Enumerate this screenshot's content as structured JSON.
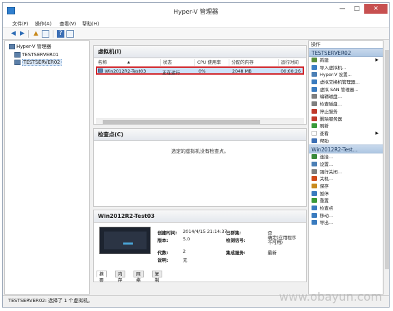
{
  "window": {
    "title": "Hyper-V 管理器",
    "minimize": "—",
    "maximize": "□",
    "close": "✕"
  },
  "menu": [
    "文件(F)",
    "操作(A)",
    "查看(V)",
    "帮助(H)"
  ],
  "tree": {
    "root": "Hyper-V 管理器",
    "servers": [
      "TESTSERVER01",
      "TESTSERVER02"
    ]
  },
  "vm_panel": {
    "title": "虚拟机(I)",
    "columns": [
      "名称",
      "状态",
      "CPU 使用率",
      "分配的内存",
      "运行时间"
    ],
    "rows": [
      {
        "name": "Win2012R2-Test03",
        "state": "正在运行",
        "cpu": "0%",
        "memory": "2048 MB",
        "uptime": "00:00:26"
      }
    ]
  },
  "checkpoint_panel": {
    "title": "检查点(C)",
    "empty_message": "选定的虚拟机没有检查点。"
  },
  "details": {
    "title": "Win2012R2-Test03",
    "fields": [
      {
        "label": "创建时间:",
        "value": "2014/4/15 21:14:37"
      },
      {
        "label": "版本:",
        "value": "5.0"
      },
      {
        "label": "代数:",
        "value": "2"
      },
      {
        "label": "说明:",
        "value": "无"
      },
      {
        "label": "已群集:",
        "value": "否"
      },
      {
        "label": "检测信号:",
        "value": "确定(应用程序不可用)"
      },
      {
        "label": "集成服务:",
        "value": "最新"
      }
    ],
    "tabs": [
      "摘要",
      "内存",
      "网络",
      "复制"
    ]
  },
  "actions": {
    "header": "操作",
    "server_group": "TESTSERVER02",
    "server_items": [
      {
        "label": "新建",
        "icon": "new-icon",
        "color": "#5a8f3c",
        "submenu": true
      },
      {
        "label": "导入虚拟机...",
        "icon": "import-icon",
        "color": "#3c7fc4"
      },
      {
        "label": "Hyper-V 设置...",
        "icon": "settings-icon",
        "color": "#4b7fb5"
      },
      {
        "label": "虚拟交换机管理器...",
        "icon": "switch-icon",
        "color": "#3a7bbf"
      },
      {
        "label": "虚拟 SAN 管理器...",
        "icon": "san-icon",
        "color": "#3a7bbf"
      },
      {
        "label": "编辑磁盘...",
        "icon": "edit-disk-icon",
        "color": "#7f7f7f"
      },
      {
        "label": "检查磁盘...",
        "icon": "inspect-disk-icon",
        "color": "#7f7f7f"
      },
      {
        "label": "停止服务",
        "icon": "stop-service-icon",
        "color": "#c0392b"
      },
      {
        "label": "删除服务器",
        "icon": "remove-server-icon",
        "color": "#c0392b"
      },
      {
        "label": "刷新",
        "icon": "refresh-icon",
        "color": "#3a9a3a"
      },
      {
        "label": "查看",
        "icon": "view-icon",
        "color": "#ffffff",
        "submenu": true
      },
      {
        "label": "帮助",
        "icon": "help-icon",
        "color": "#3c6fb5"
      }
    ],
    "vm_group": "Win2012R2-Test...",
    "vm_items": [
      {
        "label": "连接...",
        "icon": "connect-icon",
        "color": "#3a8a3a"
      },
      {
        "label": "设置...",
        "icon": "vm-settings-icon",
        "color": "#4b7fb5"
      },
      {
        "label": "强行关闭...",
        "icon": "turn-off-icon",
        "color": "#7f7f7f"
      },
      {
        "label": "关机...",
        "icon": "shutdown-icon",
        "color": "#d04a1a"
      },
      {
        "label": "保存",
        "icon": "save-icon",
        "color": "#c98a1e"
      },
      {
        "label": "暂停",
        "icon": "pause-icon",
        "color": "#3a7bbf"
      },
      {
        "label": "重置",
        "icon": "reset-icon",
        "color": "#3a9a3a"
      },
      {
        "label": "检查点",
        "icon": "checkpoint-icon",
        "color": "#3a7bbf"
      },
      {
        "label": "移动...",
        "icon": "move-icon",
        "color": "#3a7bbf"
      },
      {
        "label": "导出...",
        "icon": "export-icon",
        "color": "#3a7bbf"
      }
    ]
  },
  "status": "TESTSERVER02:  选择了 1 个虚拟机。",
  "watermark": "www.obayun.com"
}
